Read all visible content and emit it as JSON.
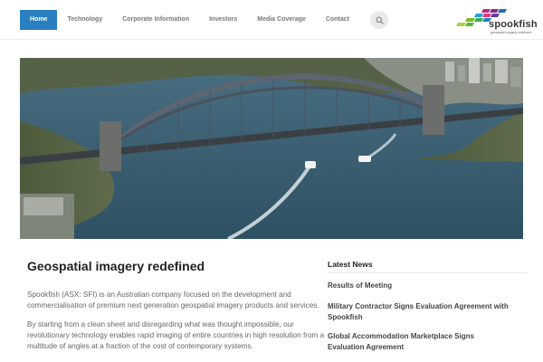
{
  "nav": {
    "items": [
      {
        "label": "Home",
        "active": true
      },
      {
        "label": "Technology",
        "active": false
      },
      {
        "label": "Corporate Information",
        "active": false
      },
      {
        "label": "Investors",
        "active": false
      },
      {
        "label": "Media Coverage",
        "active": false
      },
      {
        "label": "Contact",
        "active": false
      }
    ],
    "search_icon": "search-icon"
  },
  "logo": {
    "wordmark": "spookfish",
    "tagline": "geospatial imagery redefined"
  },
  "hero": {
    "subject": "aerial view of harbour bridge with ferries"
  },
  "main": {
    "title": "Geospatial imagery redefined",
    "paragraphs": [
      "Spookfish (ASX: SFI) is an Australian company focused on the development and commercialisation of premium next generation geospatial imagery products and services.",
      "By starting from a clean sheet and disregarding what was thought impossible, our revolutionary technology enables rapid imaging of entire countries in high resolution from a multitude of angles at a fraction of the cost of contemporary systems."
    ]
  },
  "sidebar": {
    "heading": "Latest News",
    "news": [
      "Results of Meeting",
      "Military Contractor Signs Evaluation Agreement with Spookfish",
      "Global Accommodation Marketplace Signs Evaluation Agreement"
    ]
  },
  "colors": {
    "accent": "#2a7fc0",
    "logo_green": "#7ab929",
    "logo_magenta": "#c2288c",
    "logo_blue": "#2a6ab5"
  }
}
